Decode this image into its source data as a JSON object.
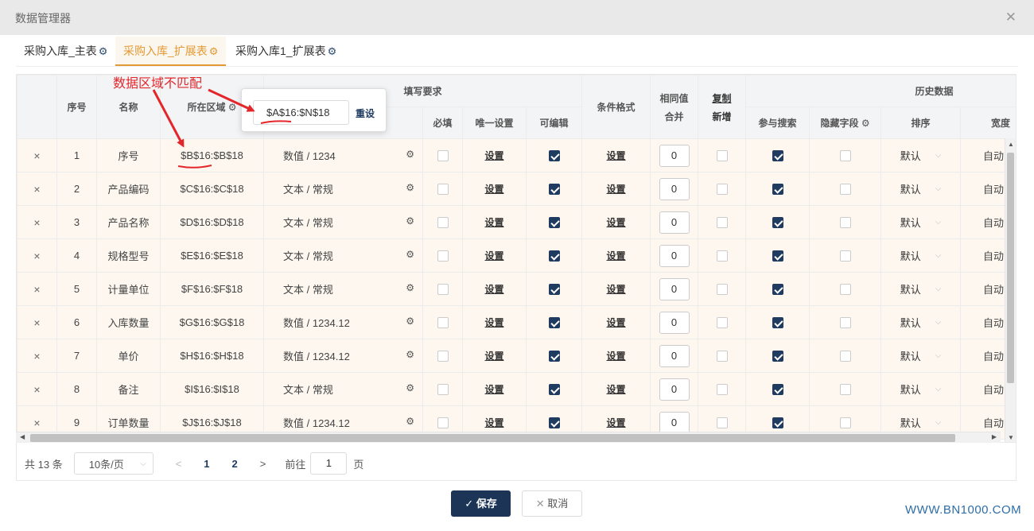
{
  "window": {
    "title": "数据管理器",
    "close_icon": "close-icon"
  },
  "tabs": [
    {
      "label": "采购入库_主表",
      "active": false
    },
    {
      "label": "采购入库_扩展表",
      "active": true
    },
    {
      "label": "采购入库1_扩展表",
      "active": false
    }
  ],
  "headers": {
    "seq": "序号",
    "name": "名称",
    "range": "所在区域",
    "fill_group": "填写要求",
    "required": "必填",
    "unique": "唯一设置",
    "editable": "可编辑",
    "cond_format": "条件格式",
    "merge_same_line1": "相同值",
    "merge_same_line2": "合并",
    "copy_new_line1": "复制",
    "copy_new_line2": "新增",
    "history_group": "历史数据",
    "join_search": "参与搜索",
    "hidden_field": "隐藏字段",
    "sort": "排序",
    "width": "宽度"
  },
  "rows": [
    {
      "seq": "1",
      "name": "序号",
      "range": "$B$16:$B$18",
      "type": "数值 / 1234",
      "required": false,
      "unique": "设置",
      "editable": true,
      "cond": "设置",
      "merge": "0",
      "copy": false,
      "search": true,
      "hidden": false,
      "sort": "默认",
      "width": "自动"
    },
    {
      "seq": "2",
      "name": "产品编码",
      "range": "$C$16:$C$18",
      "type": "文本 / 常规",
      "required": false,
      "unique": "设置",
      "editable": true,
      "cond": "设置",
      "merge": "0",
      "copy": false,
      "search": true,
      "hidden": false,
      "sort": "默认",
      "width": "自动"
    },
    {
      "seq": "3",
      "name": "产品名称",
      "range": "$D$16:$D$18",
      "type": "文本 / 常规",
      "required": false,
      "unique": "设置",
      "editable": true,
      "cond": "设置",
      "merge": "0",
      "copy": false,
      "search": true,
      "hidden": false,
      "sort": "默认",
      "width": "自动"
    },
    {
      "seq": "4",
      "name": "规格型号",
      "range": "$E$16:$E$18",
      "type": "文本 / 常规",
      "required": false,
      "unique": "设置",
      "editable": true,
      "cond": "设置",
      "merge": "0",
      "copy": false,
      "search": true,
      "hidden": false,
      "sort": "默认",
      "width": "自动"
    },
    {
      "seq": "5",
      "name": "计量单位",
      "range": "$F$16:$F$18",
      "type": "文本 / 常规",
      "required": false,
      "unique": "设置",
      "editable": true,
      "cond": "设置",
      "merge": "0",
      "copy": false,
      "search": true,
      "hidden": false,
      "sort": "默认",
      "width": "自动"
    },
    {
      "seq": "6",
      "name": "入库数量",
      "range": "$G$16:$G$18",
      "type": "数值 / 1234.12",
      "required": false,
      "unique": "设置",
      "editable": true,
      "cond": "设置",
      "merge": "0",
      "copy": false,
      "search": true,
      "hidden": false,
      "sort": "默认",
      "width": "自动"
    },
    {
      "seq": "7",
      "name": "单价",
      "range": "$H$16:$H$18",
      "type": "数值 / 1234.12",
      "required": false,
      "unique": "设置",
      "editable": true,
      "cond": "设置",
      "merge": "0",
      "copy": false,
      "search": true,
      "hidden": false,
      "sort": "默认",
      "width": "自动"
    },
    {
      "seq": "8",
      "name": "备注",
      "range": "$I$16:$I$18",
      "type": "文本 / 常规",
      "required": false,
      "unique": "设置",
      "editable": true,
      "cond": "设置",
      "merge": "0",
      "copy": false,
      "search": true,
      "hidden": false,
      "sort": "默认",
      "width": "自动"
    },
    {
      "seq": "9",
      "name": "订单数量",
      "range": "$J$16:$J$18",
      "type": "数值 / 1234.12",
      "required": false,
      "unique": "设置",
      "editable": true,
      "cond": "设置",
      "merge": "0",
      "copy": false,
      "search": true,
      "hidden": false,
      "sort": "默认",
      "width": "自动"
    }
  ],
  "row_delete_glyph": "×",
  "popover": {
    "value": "$A$16:$N$18",
    "reset_label": "重设"
  },
  "annotation": {
    "text": "数据区域不匹配",
    "color": "#e3262a"
  },
  "pager": {
    "total": "共 13 条",
    "page_size": "10条/页",
    "pages": [
      "1",
      "2"
    ],
    "current_page": "1",
    "goto_label": "前往",
    "goto_value": "1",
    "page_unit": "页"
  },
  "buttons": {
    "save": "保存",
    "cancel": "取消"
  },
  "watermark": "WWW.BN1000.COM",
  "colors": {
    "accent": "#e39a34",
    "primary": "#1c3557",
    "row_bg": "#fdf7ef",
    "annotation": "#e3262a"
  }
}
